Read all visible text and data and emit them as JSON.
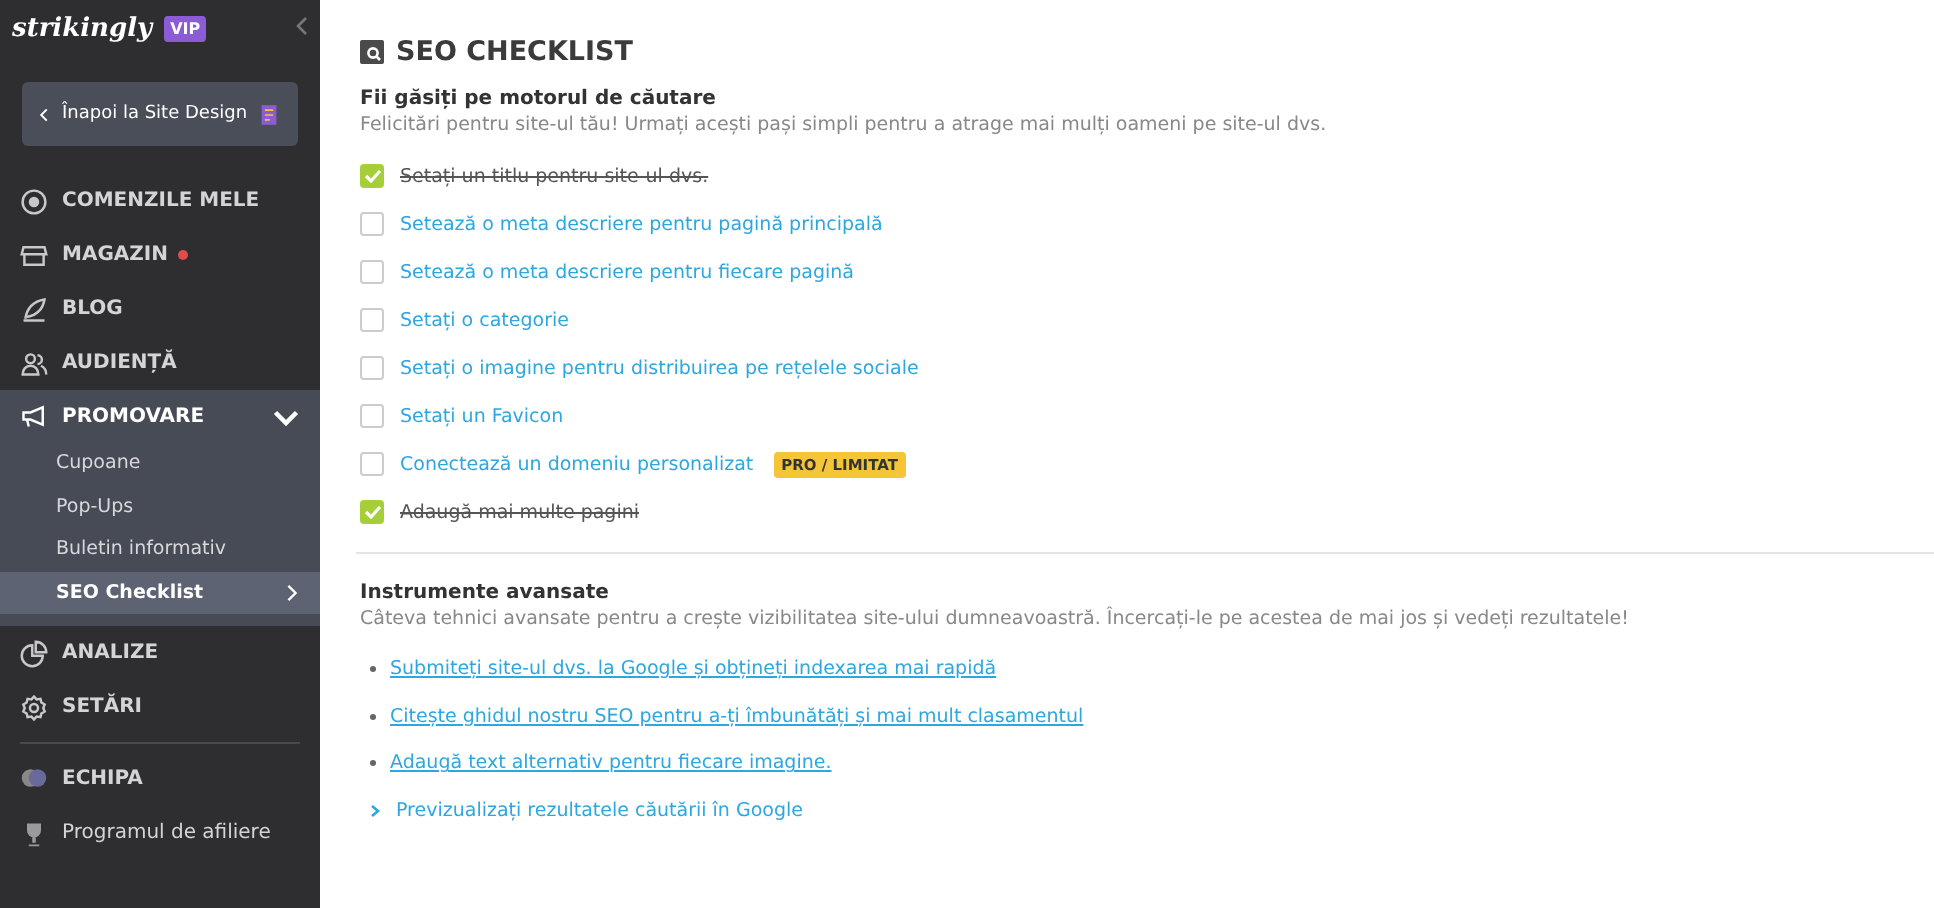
{
  "sidebar": {
    "logo": "strikingly",
    "plan_badge": "VIP",
    "back_button": "Înapoi la Site Design",
    "items": [
      {
        "label": "COMENZILE MELE",
        "notification": false
      },
      {
        "label": "MAGAZIN",
        "notification": true
      },
      {
        "label": "BLOG",
        "notification": false
      },
      {
        "label": "AUDIENȚĂ",
        "notification": false
      },
      {
        "label": "PROMOVARE",
        "notification": false,
        "expanded": true,
        "children": [
          {
            "label": "Cupoane",
            "selected": false
          },
          {
            "label": "Pop-Ups",
            "selected": false
          },
          {
            "label": "Buletin informativ",
            "selected": false
          },
          {
            "label": "SEO Checklist",
            "selected": true
          }
        ]
      },
      {
        "label": "ANALIZE",
        "notification": false
      },
      {
        "label": "SETĂRI",
        "notification": false
      },
      {
        "label": "ECHIPA",
        "notification": false,
        "divider_before": true
      },
      {
        "label": "Programul de afiliere",
        "notification": false,
        "plain": true
      }
    ]
  },
  "main": {
    "title": "SEO CHECKLIST",
    "checklist": {
      "heading": "Fii găsiți pe motorul de căutare",
      "description": "Felicitări pentru site-ul tău! Urmați acești pași simpli pentru a atrage mai mulți oameni pe site-ul dvs.",
      "items": [
        {
          "label": "Setați un titlu pentru site-ul dvs.",
          "checked": true
        },
        {
          "label": "Setează o meta descriere pentru pagină principală",
          "checked": false
        },
        {
          "label": "Setează o meta descriere pentru fiecare pagină",
          "checked": false
        },
        {
          "label": "Setați o categorie",
          "checked": false
        },
        {
          "label": "Setați o imagine pentru distribuirea pe rețelele sociale",
          "checked": false
        },
        {
          "label": "Setați un Favicon",
          "checked": false
        },
        {
          "label": "Conectează un domeniu personalizat",
          "checked": false,
          "badge": "PRO / LIMITAT"
        },
        {
          "label": "Adaugă mai multe pagini",
          "checked": true
        }
      ]
    },
    "advanced": {
      "heading": "Instrumente avansate",
      "description": "Câteva tehnici avansate pentru a crește vizibilitatea site-ului dumneavoastră. Încercați-le pe acestea de mai jos și vedeți rezultatele!",
      "links": [
        {
          "label": "Submiteți site-ul dvs. la Google și obțineți indexarea mai rapidă",
          "kind": "bullet"
        },
        {
          "label": "Citește ghidul nostru SEO pentru a-ți îmbunătăți și mai mult clasamentul",
          "kind": "bullet"
        },
        {
          "label": "Adaugă text alternativ pentru fiecare imagine.",
          "kind": "bullet"
        },
        {
          "label": "Previzualizați rezultatele căutării în Google",
          "kind": "expander"
        }
      ]
    }
  }
}
